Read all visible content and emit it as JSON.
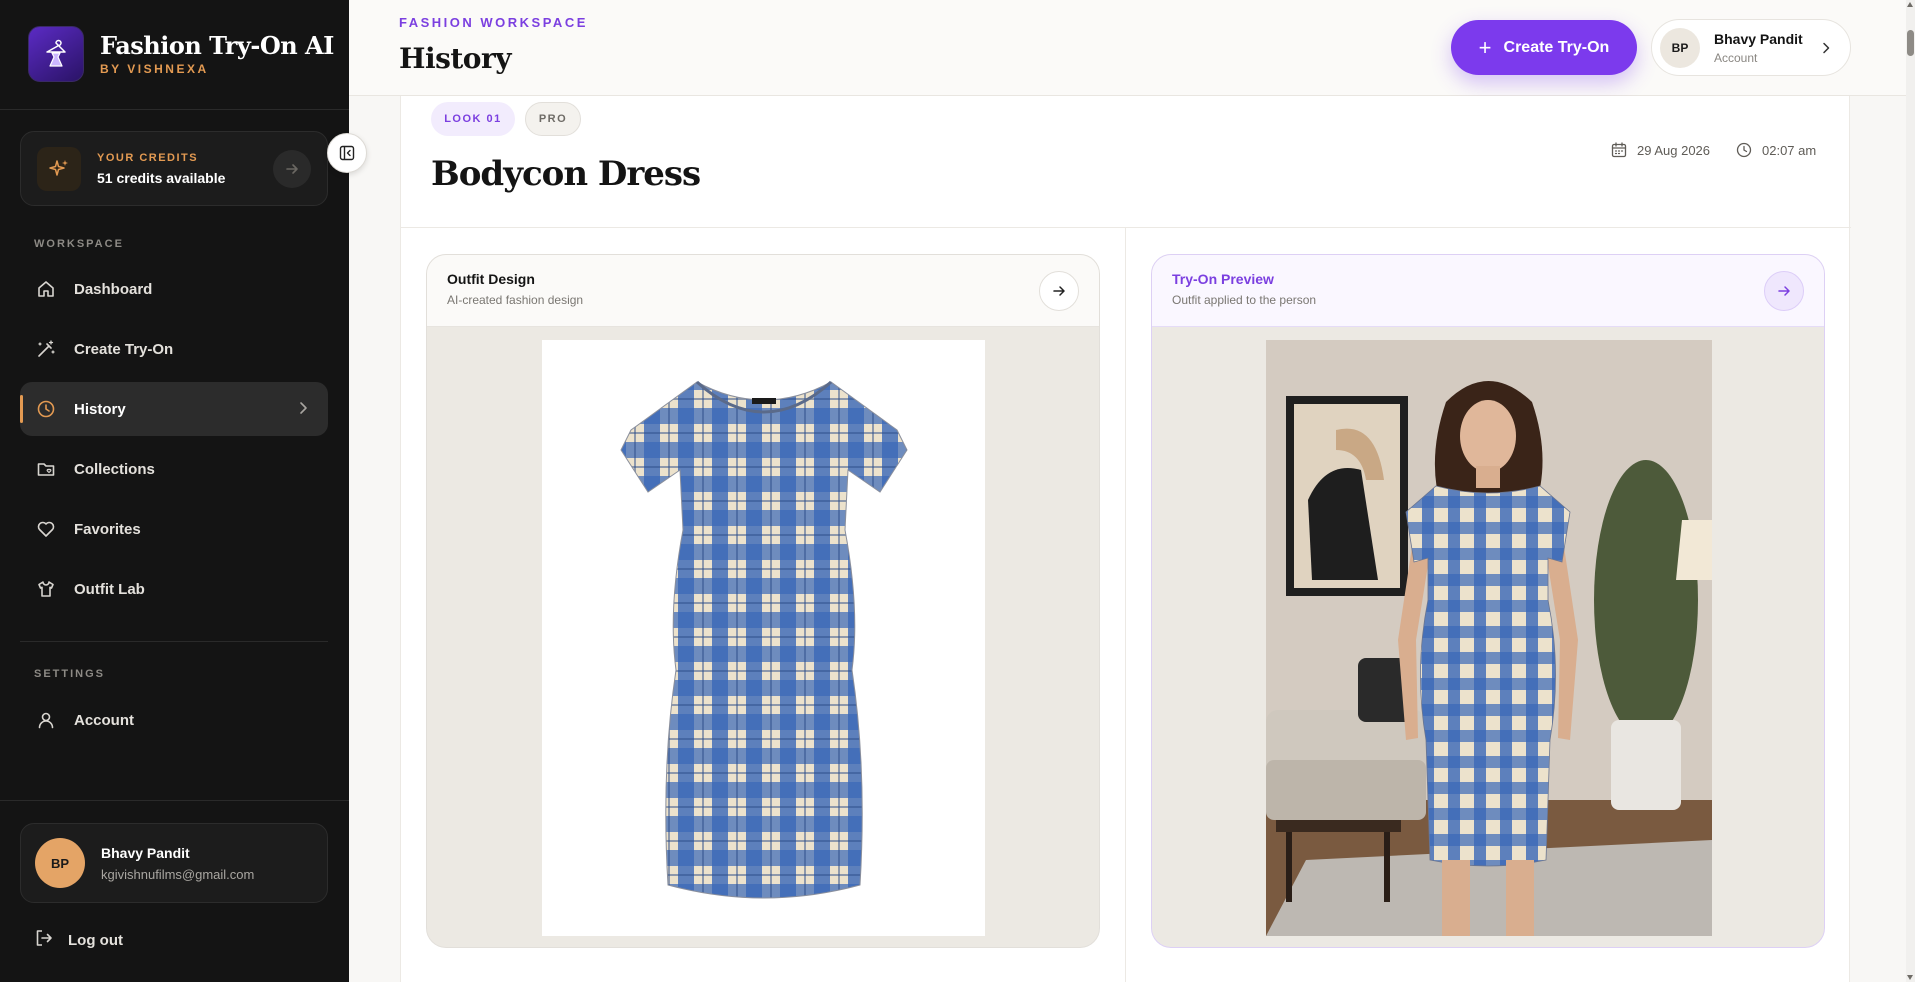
{
  "brand": {
    "title": "Fashion Try-On AI",
    "subtitle": "BY VISHNEXA",
    "logo_icon": "dress-hanger-icon"
  },
  "credits": {
    "label": "YOUR CREDITS",
    "value": "51 credits available",
    "icon": "sparkle-icon"
  },
  "sidebar": {
    "workspace_label": "WORKSPACE",
    "settings_label": "SETTINGS",
    "items": [
      {
        "label": "Dashboard",
        "icon": "home-icon"
      },
      {
        "label": "Create Try-On",
        "icon": "magic-wand-icon"
      },
      {
        "label": "History",
        "icon": "clock-icon",
        "active": true
      },
      {
        "label": "Collections",
        "icon": "folder-icon"
      },
      {
        "label": "Favorites",
        "icon": "heart-icon"
      },
      {
        "label": "Outfit Lab",
        "icon": "shirt-icon"
      }
    ],
    "settings_items": [
      {
        "label": "Account",
        "icon": "user-icon"
      }
    ]
  },
  "user": {
    "initials": "BP",
    "name": "Bhavy Pandit",
    "email": "kgivishnufilms@gmail.com"
  },
  "logout": {
    "label": "Log out",
    "icon": "logout-icon"
  },
  "header": {
    "eyebrow": "FASHION WORKSPACE",
    "title": "History",
    "create_button": "Create Try-On",
    "account": {
      "initials": "BP",
      "name": "Bhavy Pandit",
      "sub": "Account"
    }
  },
  "look": {
    "tag": "LOOK 01",
    "tier": "PRO",
    "title": "Bodycon Dress",
    "date": "29 Aug 2026",
    "time": "02:07 am"
  },
  "panels": {
    "design": {
      "title": "Outfit Design",
      "subtitle": "AI-created fashion design"
    },
    "preview": {
      "title": "Try-On Preview",
      "subtitle": "Outfit applied to the person"
    }
  },
  "colors": {
    "accent": "#7c3aed",
    "brand_orange": "#e39a52",
    "sidebar_bg": "#141414",
    "plaid_blue": "#3968b8",
    "plaid_cream": "#ece2cc"
  }
}
